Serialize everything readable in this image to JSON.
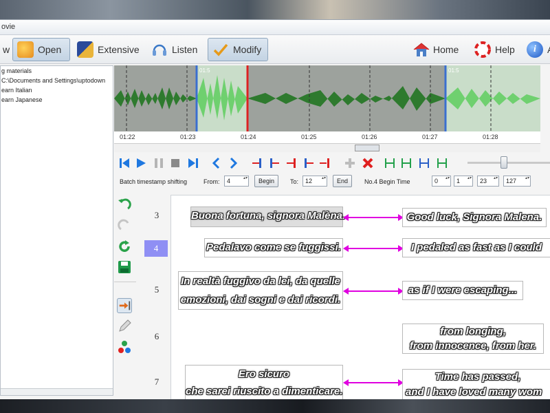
{
  "window": {
    "title": "ovie"
  },
  "toolbar": {
    "left_cut": "w",
    "open": "Open",
    "extensive": "Extensive",
    "listen": "Listen",
    "modify": "Modify",
    "home": "Home",
    "help": "Help",
    "about_cut": "A"
  },
  "tree": {
    "items": [
      "g materials",
      "C:\\Documents and Settings\\uptodown",
      "earn Italian",
      "earn Japanese"
    ]
  },
  "timeline": {
    "ticks": [
      "01:22",
      "01:23",
      "01:24",
      "01:25",
      "01:26",
      "01:27",
      "01:28"
    ],
    "marker1": "01:5",
    "marker2": "01:5"
  },
  "batch": {
    "label": "Batch timestamp shifting",
    "from_label": "From:",
    "from_value": "4",
    "begin_btn": "Begin",
    "to_label": "To:",
    "to_value": "12",
    "end_btn": "End",
    "no_label": "No.4 Begin Time",
    "t_h": "0",
    "t_m": "1",
    "t_s": "23",
    "t_ms": "127"
  },
  "rows": [
    {
      "num": "3",
      "left": "Buona fortuna, signora Malèna.",
      "right": "Good luck, Signora Malena."
    },
    {
      "num": "4",
      "left": "Pedalavo come se fuggissi.",
      "right": "I pedaled as fast as I could"
    },
    {
      "num": "5",
      "left_1": "In realtà fuggivo da lei, da quelle",
      "left_2": "emozioni, dai sogni e dai ricordi.",
      "right": "as if I were escaping..."
    },
    {
      "num": "6",
      "right_1": "from longing,",
      "right_2": "from innocence, from her."
    },
    {
      "num": "7",
      "left_1": "Ero sicuro",
      "left_2": "che sarei riuscito a dimenticare.",
      "right_1": "Time has passed,",
      "right_2": "and I have loved many wom"
    }
  ],
  "colors": {
    "link": "#e000e0",
    "selected_row": "#8f8ff4",
    "wave_selected": "#6fd06f",
    "wave": "#2e7a2e"
  }
}
